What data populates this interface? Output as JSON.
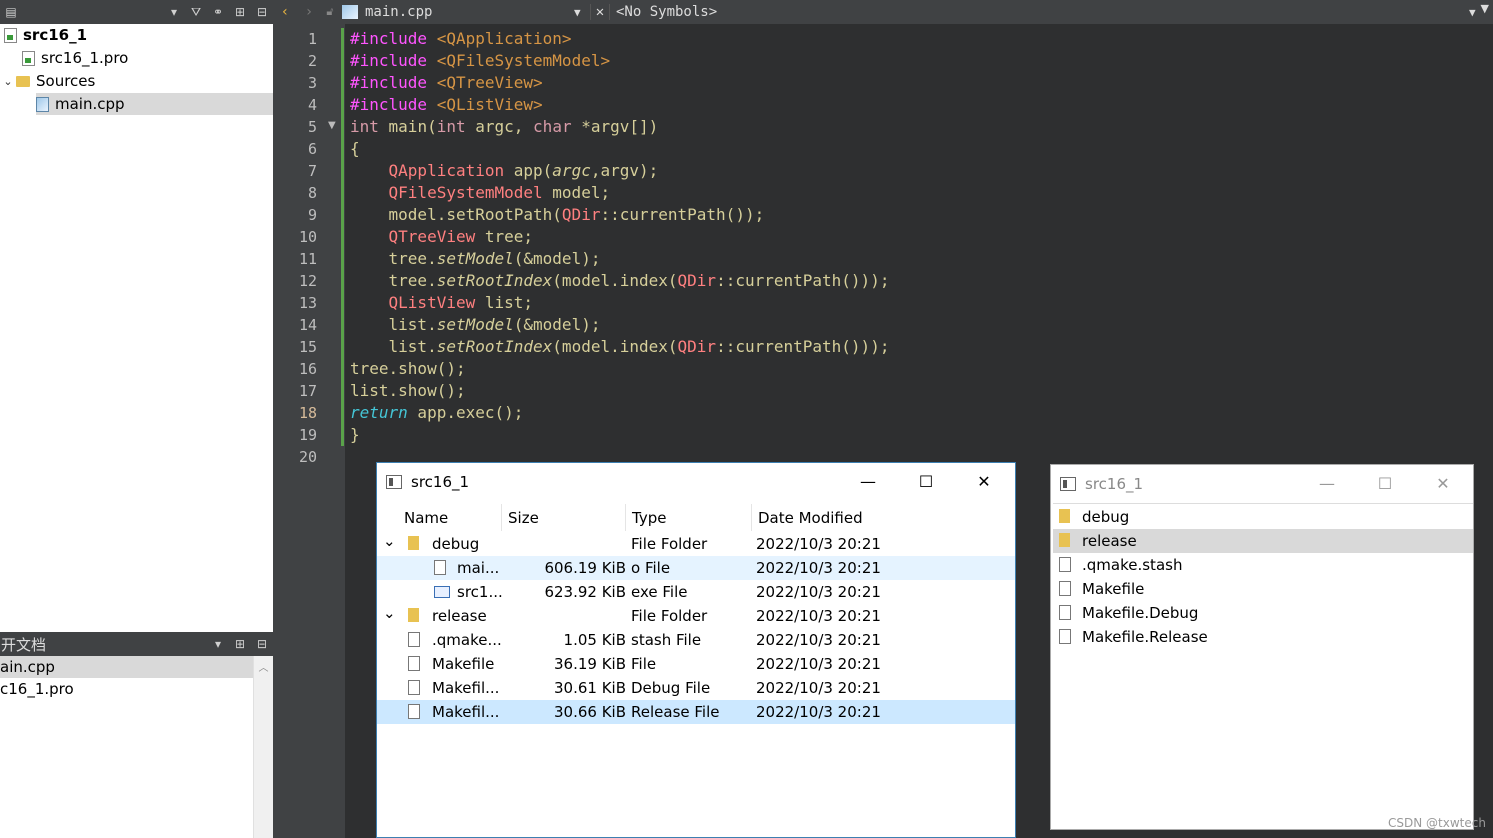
{
  "project_panel": {
    "items": [
      {
        "label": "src16_1",
        "kind": "project",
        "bold": true
      },
      {
        "label": "src16_1.pro",
        "kind": "pro-file"
      },
      {
        "label": "Sources",
        "kind": "folder"
      },
      {
        "label": "main.cpp",
        "kind": "cpp-file",
        "selected": true
      }
    ]
  },
  "open_docs": {
    "title": "开文档",
    "items": [
      {
        "label": "ain.cpp",
        "selected": true
      },
      {
        "label": "c16_1.pro",
        "selected": false
      }
    ]
  },
  "editor": {
    "file_name": "main.cpp",
    "symbols": "<No Symbols>",
    "current_line": "18",
    "line_numbers": [
      "1",
      "2",
      "3",
      "4",
      "5",
      "6",
      "7",
      "8",
      "9",
      "10",
      "11",
      "12",
      "13",
      "14",
      "15",
      "16",
      "17",
      "18",
      "19",
      "20"
    ],
    "lines": [
      [
        [
          "pp",
          "#include "
        ],
        [
          "inc",
          "<QApplication>"
        ]
      ],
      [
        [
          "pp",
          "#include "
        ],
        [
          "inc",
          "<QFileSystemModel>"
        ]
      ],
      [
        [
          "pp",
          "#include "
        ],
        [
          "inc",
          "<QTreeView>"
        ]
      ],
      [
        [
          "pp",
          "#include "
        ],
        [
          "inc",
          "<QListView>"
        ]
      ],
      [
        [
          "kw",
          "int"
        ],
        [
          "pl",
          " main("
        ],
        [
          "kw",
          "int"
        ],
        [
          "pl",
          " argc, "
        ],
        [
          "kw",
          "char"
        ],
        [
          "pl",
          " *argv[])"
        ]
      ],
      [
        [
          "pl",
          "{"
        ]
      ],
      [
        [
          "pl",
          "    "
        ],
        [
          "ty",
          "QApplication"
        ],
        [
          "pl",
          " app("
        ],
        [
          "it",
          "argc"
        ],
        [
          "pl",
          ",argv);"
        ]
      ],
      [
        [
          "pl",
          "    "
        ],
        [
          "ty",
          "QFileSystemModel"
        ],
        [
          "pl",
          " model;"
        ]
      ],
      [
        [
          "pl",
          "    model.setRootPath("
        ],
        [
          "ty",
          "QDir"
        ],
        [
          "pl",
          "::currentPath());"
        ]
      ],
      [
        [
          "pl",
          "    "
        ],
        [
          "ty",
          "QTreeView"
        ],
        [
          "pl",
          " tree;"
        ]
      ],
      [
        [
          "pl",
          "    tree."
        ],
        [
          "it",
          "setModel"
        ],
        [
          "pl",
          "(&model);"
        ]
      ],
      [
        [
          "pl",
          "    tree."
        ],
        [
          "it",
          "setRootIndex"
        ],
        [
          "pl",
          "(model.index("
        ],
        [
          "ty",
          "QDir"
        ],
        [
          "pl",
          "::currentPath()));"
        ]
      ],
      [
        [
          "pl",
          "    "
        ],
        [
          "ty",
          "QListView"
        ],
        [
          "pl",
          " list;"
        ]
      ],
      [
        [
          "pl",
          "    list."
        ],
        [
          "it",
          "setModel"
        ],
        [
          "pl",
          "(&model);"
        ]
      ],
      [
        [
          "pl",
          "    list."
        ],
        [
          "it",
          "setRootIndex"
        ],
        [
          "pl",
          "(model.index("
        ],
        [
          "ty",
          "QDir"
        ],
        [
          "pl",
          "::currentPath()));"
        ]
      ],
      [
        [
          "pl",
          "tree.show();"
        ]
      ],
      [
        [
          "pl",
          "list.show();"
        ]
      ],
      [
        [
          "ret",
          "return"
        ],
        [
          "pl",
          " app.exec();"
        ]
      ],
      [
        [
          "pl",
          "}"
        ]
      ],
      [
        [
          "pl",
          ""
        ]
      ]
    ]
  },
  "tree_window": {
    "title": "src16_1",
    "buttons": {
      "minimize": "—",
      "maximize": "☐",
      "close": "✕"
    },
    "headers": [
      "Name",
      "Size",
      "Type",
      "Date Modified"
    ],
    "rows": [
      {
        "name": "debug",
        "size": "",
        "type": "File Folder",
        "date": "2022/10/3 20:21",
        "level": 0,
        "icon": "folder",
        "expanded": true,
        "state": ""
      },
      {
        "name": "mai...",
        "size": "606.19 KiB",
        "type": "o File",
        "date": "2022/10/3 20:21",
        "level": 1,
        "icon": "doc",
        "state": "hover"
      },
      {
        "name": "src1...",
        "size": "623.92 KiB",
        "type": "exe File",
        "date": "2022/10/3 20:21",
        "level": 1,
        "icon": "exe",
        "state": ""
      },
      {
        "name": "release",
        "size": "",
        "type": "File Folder",
        "date": "2022/10/3 20:21",
        "level": 0,
        "icon": "folder",
        "expanded": true,
        "state": ""
      },
      {
        "name": ".qmake...",
        "size": "1.05 KiB",
        "type": "stash File",
        "date": "2022/10/3 20:21",
        "level": 0,
        "icon": "doc",
        "state": ""
      },
      {
        "name": "Makefile",
        "size": "36.19 KiB",
        "type": "File",
        "date": "2022/10/3 20:21",
        "level": 0,
        "icon": "doc",
        "state": ""
      },
      {
        "name": "Makefil...",
        "size": "30.61 KiB",
        "type": "Debug File",
        "date": "2022/10/3 20:21",
        "level": 0,
        "icon": "doc",
        "state": ""
      },
      {
        "name": "Makefil...",
        "size": "30.66 KiB",
        "type": "Release File",
        "date": "2022/10/3 20:21",
        "level": 0,
        "icon": "doc",
        "state": "selected"
      }
    ]
  },
  "list_window": {
    "title": "src16_1",
    "buttons": {
      "minimize": "—",
      "maximize": "☐",
      "close": "✕"
    },
    "items": [
      {
        "name": "debug",
        "icon": "folder",
        "selected": false
      },
      {
        "name": "release",
        "icon": "folder",
        "selected": true
      },
      {
        "name": ".qmake.stash",
        "icon": "doc",
        "selected": false
      },
      {
        "name": "Makefile",
        "icon": "doc",
        "selected": false
      },
      {
        "name": "Makefile.Debug",
        "icon": "doc",
        "selected": false
      },
      {
        "name": "Makefile.Release",
        "icon": "doc",
        "selected": false
      }
    ]
  },
  "watermark": "CSDN @txwtech"
}
